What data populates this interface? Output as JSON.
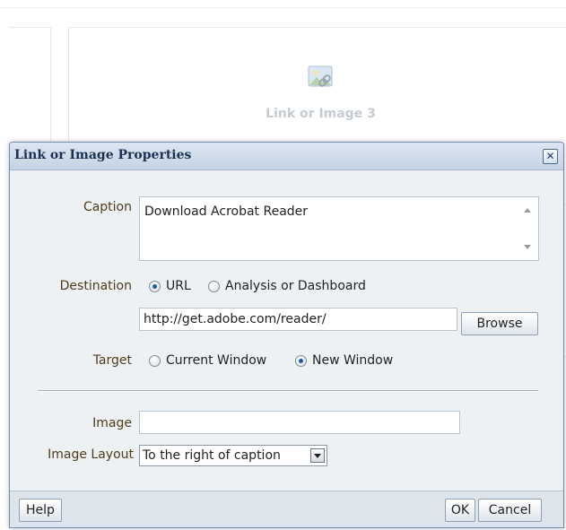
{
  "background": {
    "placeholder_label": "Link or Image 3",
    "placeholder_icon": "image-link-icon"
  },
  "dialog": {
    "title": "Link or Image Properties",
    "close_icon": "close-icon",
    "caption": {
      "label": "Caption",
      "value": "Download Acrobat Reader"
    },
    "destination": {
      "label": "Destination",
      "options": [
        "URL",
        "Analysis or Dashboard"
      ],
      "selected": "URL",
      "url_value": "http://get.adobe.com/reader/",
      "browse_label": "Browse"
    },
    "target": {
      "label": "Target",
      "options": [
        "Current Window",
        "New Window"
      ],
      "selected": "New Window"
    },
    "image": {
      "label": "Image",
      "value": ""
    },
    "image_layout": {
      "label": "Image Layout",
      "value": "To the right of caption"
    },
    "footer": {
      "help_label": "Help",
      "ok_label": "OK",
      "cancel_label": "Cancel"
    }
  },
  "colors": {
    "label_text": "#4e3b17",
    "title_text": "#1b3152",
    "radio_selected": "#1e5aa8"
  }
}
